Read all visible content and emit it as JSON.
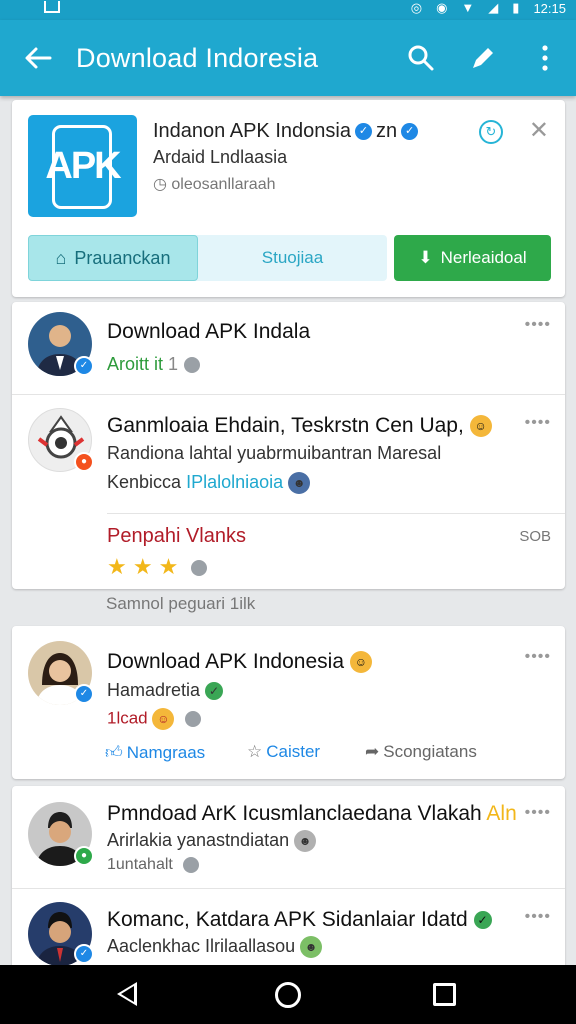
{
  "status_bar": {
    "time": "12:15"
  },
  "app_bar": {
    "title": "Download Indoresia"
  },
  "top_card": {
    "app_name": "Indanon APK Indonsia",
    "name_suffix": "zn",
    "subtitle": "Ardaid Lndlaasia",
    "meta": "oleosanllaraah",
    "tab_active": "Prauanckan",
    "tab_inactive": "Stuojiaa",
    "download_button": "Nerleaidoal",
    "accent_color": "#1fa8cf",
    "download_color": "#2ea94a"
  },
  "feed": {
    "post1": {
      "title": "Download APK Indala",
      "meta": "Aroitt it",
      "count": "1"
    },
    "post2": {
      "title": "Ganmloaia Ehdain, Teskrstn Cen Uap,",
      "line1": "Randiona lahtal yuabrmuibantran Maresal",
      "line2_prefix": "Kenbicca",
      "line2_link": "IPlalolniaoia",
      "red_title": "Penpahi Vlanks",
      "side_value": "SOB",
      "stars": "3 of 3"
    },
    "section_label": "Samnol peguari 1ilk",
    "post3": {
      "title": "Download APK Indonesia",
      "meta": "Hamadretia",
      "count": "1lcad",
      "action_like": "Namgraas",
      "action_fav": "Caister",
      "action_share": "Scongiatans"
    },
    "post4": {
      "title": "Pmndoad ArK Icusmlanclaedana Vlakah",
      "title_suffix": "Aln",
      "line1": "Arirlakia yanastndiatan",
      "meta": "1untahalt"
    },
    "post5": {
      "title": "Komanc, Katdara APK Sidanlaiar Idatd",
      "line1": "Aaclenkhac Ilrilaallasou"
    }
  }
}
